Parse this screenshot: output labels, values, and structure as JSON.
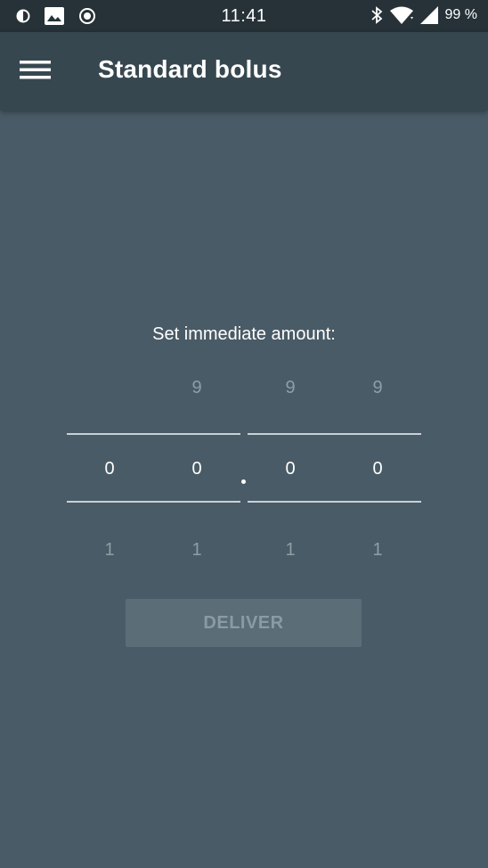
{
  "status_bar": {
    "time": "11:41",
    "battery": "99 %",
    "left_icons": [
      "data-saver-icon",
      "image-icon",
      "record-icon"
    ],
    "right_icons": [
      "bluetooth-icon",
      "wifi-icon",
      "signal-icon"
    ]
  },
  "app_bar": {
    "title": "Standard bolus",
    "menu_icon": "hamburger-menu-icon"
  },
  "picker": {
    "prompt": "Set immediate amount:",
    "columns": [
      {
        "above": "",
        "value": "0",
        "below": "1"
      },
      {
        "above": "9",
        "value": "0",
        "below": "1"
      },
      {
        "above": "9",
        "value": "0",
        "below": "1"
      },
      {
        "above": "9",
        "value": "0",
        "below": "1"
      }
    ]
  },
  "deliver_button": {
    "label": "DELIVER"
  },
  "colors": {
    "background": "#495b66",
    "app_bar": "#37474f",
    "status_bar": "#263238",
    "button_disabled": "#5b6d77"
  }
}
